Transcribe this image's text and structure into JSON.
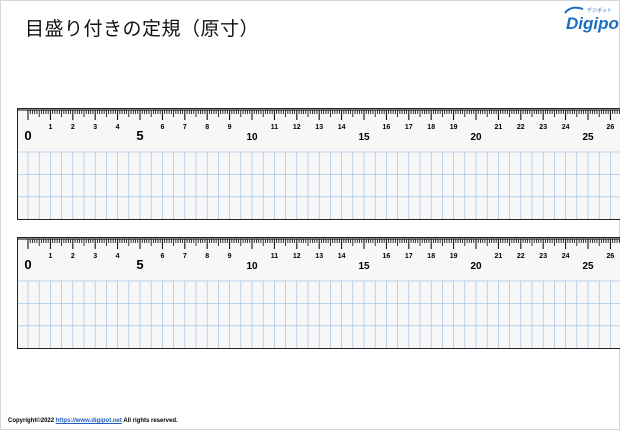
{
  "slide": {
    "title": "目盛り付きの定規（原寸）"
  },
  "logo": {
    "text": "Digipot",
    "subtext": "デジポット",
    "color": "#1a6fc4"
  },
  "rulers": [
    {
      "labels": [
        "0",
        "1",
        "2",
        "3",
        "4",
        "5",
        "6",
        "7",
        "8",
        "9",
        "10",
        "11",
        "12",
        "13",
        "14",
        "15",
        "16",
        "17",
        "18",
        "19",
        "20",
        "21",
        "22",
        "23",
        "24",
        "25",
        "26"
      ]
    },
    {
      "labels": [
        "0",
        "1",
        "2",
        "3",
        "4",
        "5",
        "6",
        "7",
        "8",
        "9",
        "10",
        "11",
        "12",
        "13",
        "14",
        "15",
        "16",
        "17",
        "18",
        "19",
        "20",
        "21",
        "22",
        "23",
        "24",
        "25",
        "26"
      ]
    }
  ],
  "colors": {
    "grid": "#a9c9e8",
    "ticks": "#000000",
    "ruler_bg": "#f7f7f7"
  },
  "footer": {
    "copyright": "Copyright©2022 ",
    "link": "https://www.digipot.net",
    "rights": " All rights reserved."
  }
}
